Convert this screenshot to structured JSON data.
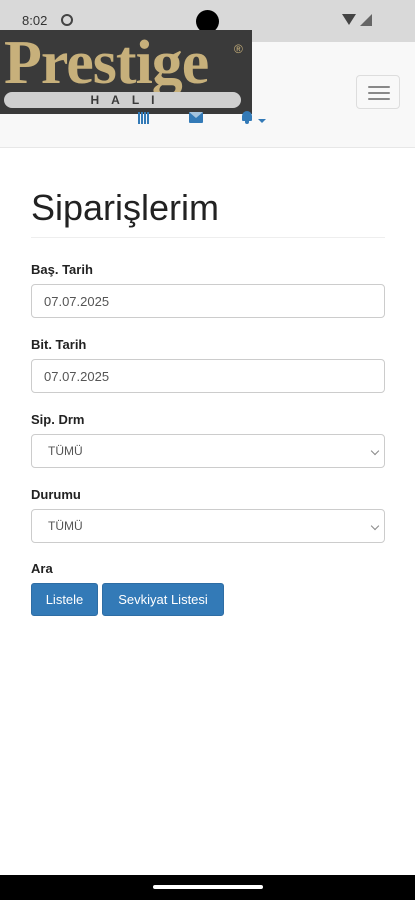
{
  "status_bar": {
    "time": "8:02"
  },
  "brand": {
    "name": "Prestige",
    "registered_mark": "®",
    "subtitle": "HALI",
    "colors": {
      "logo_gold": "#c7b07b",
      "logo_bg": "#3a3a3a"
    }
  },
  "navbar": {
    "icons": [
      "barcode-icon",
      "envelope-icon",
      "bell-icon",
      "caret-down-icon"
    ],
    "toggle_icon": "hamburger-icon"
  },
  "page": {
    "title": "Siparişlerim"
  },
  "form": {
    "start_date": {
      "label": "Baş. Tarih",
      "value": "07.07.2025"
    },
    "end_date": {
      "label": "Bit. Tarih",
      "value": "07.07.2025"
    },
    "order_status": {
      "label": "Sip. Drm",
      "selected": "TÜMÜ"
    },
    "status": {
      "label": "Durumu",
      "selected": "TÜMÜ"
    },
    "search": {
      "label": "Ara",
      "list_button": "Listele",
      "shipment_button": "Sevkiyat Listesi"
    }
  },
  "theme": {
    "primary": "#337ab7",
    "navbar_bg": "#f8f8f8",
    "status_bar_bg": "#d9d9d9"
  }
}
